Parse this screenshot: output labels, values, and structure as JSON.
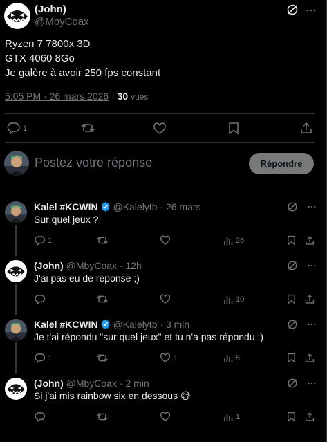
{
  "main_post": {
    "display_name": "(John)",
    "handle": "@MbyCoax",
    "lines": [
      "Ryzen 7 7800x 3D",
      "GTX 4060 8Go",
      "Je galère à avoir 250 fps constant"
    ],
    "timestamp": "5:05 PM · 26 mars 2026",
    "separator": " · ",
    "views_count": "30",
    "views_label": "vues",
    "reply_count": "1"
  },
  "composer": {
    "placeholder": "Postez votre réponse",
    "button_label": "Répondre"
  },
  "replies": [
    {
      "display_name": "Kalel #KCWIN",
      "verified": true,
      "handle": "@Kalelytb",
      "time": "· 26 mars",
      "text": "Sur quel jeux ?",
      "reply_count": "1",
      "like_count": "",
      "views": "26",
      "avatar": "kalel"
    },
    {
      "display_name": "(John)",
      "verified": false,
      "handle": "@MbyCoax",
      "time": "· 12h",
      "text": "J'ai pas eu de réponse ;)",
      "reply_count": "",
      "like_count": "",
      "views": "10",
      "avatar": "john"
    },
    {
      "display_name": "Kalel #KCWIN",
      "verified": true,
      "handle": "@Kalelytb",
      "time": "· 3 min",
      "text": "Je t'ai répondu \"sur quel jeux\" et tu n'a pas répondu :)",
      "reply_count": "1",
      "like_count": "1",
      "views": "5",
      "avatar": "kalel"
    },
    {
      "display_name": "(John)",
      "verified": false,
      "handle": "@MbyCoax",
      "time": "· 2 min",
      "text": "Si j'ai mis rainbow six en dessous 😅",
      "reply_count": "",
      "like_count": "",
      "views": "1",
      "avatar": "john"
    }
  ],
  "colors": {
    "background": "#000000",
    "text": "#e7e9ea",
    "muted": "#71767b",
    "verified": "#1d9bf0",
    "button_bg": "#787a7a",
    "divider": "#2f3336"
  },
  "icons": [
    "grok-icon",
    "reply-icon",
    "retweet-icon",
    "like-icon",
    "bookmark-icon",
    "share-icon",
    "views-icon",
    "verified-badge-icon"
  ]
}
